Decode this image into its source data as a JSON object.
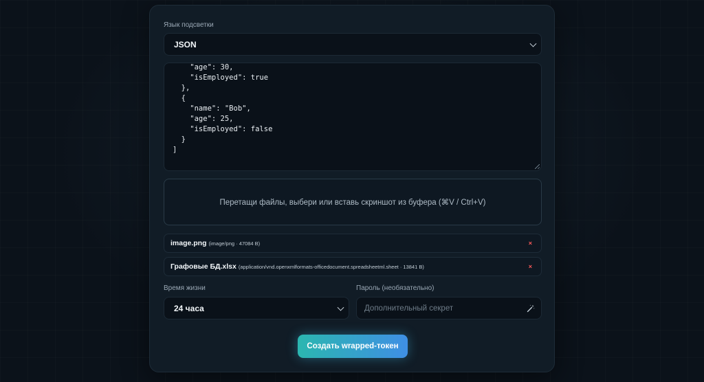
{
  "highlight": {
    "label": "Язык подсветки",
    "value": "JSON"
  },
  "code": {
    "lines": "    \"age\": 30,\n    \"isEmployed\": true\n  },\n  {\n    \"name\": \"Bob\",\n    \"age\": 25,\n    \"isEmployed\": false\n  }\n]"
  },
  "dropzone": {
    "text": "Перетащи файлы, выбери или вставь скриншот из буфера (⌘V / Ctrl+V)"
  },
  "files": [
    {
      "name": "image.png",
      "meta": "(image/png · 47084 B)",
      "remove": "×"
    },
    {
      "name": "Графовые БД.xlsx",
      "meta": "(application/vnd.openxmlformats-officedocument.spreadsheetml.sheet · 13841 B)",
      "remove": "×"
    }
  ],
  "ttl": {
    "label": "Время жизни",
    "value": "24 часа"
  },
  "password": {
    "label": "Пароль (необязательно)",
    "placeholder": "Дополнительный секрет",
    "icon": "magic-wand-icon"
  },
  "submit": {
    "label": "Создать wrapped-токен"
  },
  "colors": {
    "accent_start": "#2bb6b0",
    "accent_end": "#3f8fe4",
    "remove": "#ff5a5a"
  }
}
